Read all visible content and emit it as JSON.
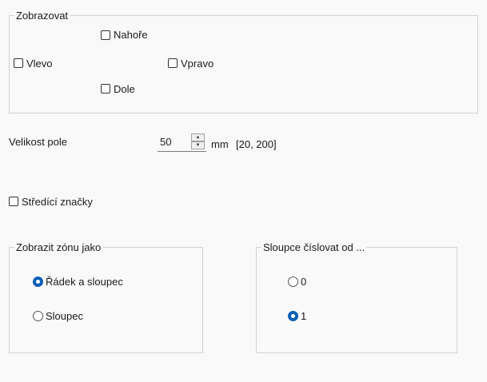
{
  "display_group": {
    "legend": "Zobrazovat",
    "top": {
      "label": "Nahoře",
      "checked": false
    },
    "left": {
      "label": "Vlevo",
      "checked": false
    },
    "right": {
      "label": "Vpravo",
      "checked": false
    },
    "bottom": {
      "label": "Dole",
      "checked": false
    }
  },
  "field_size": {
    "label": "Velikost pole",
    "value": "50",
    "unit": "mm",
    "range": "[20, 200]"
  },
  "center_marks": {
    "label": "Středící značky",
    "checked": false
  },
  "zone_group": {
    "legend": "Zobrazit zónu jako",
    "options": [
      {
        "label": "Řádek a sloupec",
        "selected": true
      },
      {
        "label": "Sloupec",
        "selected": false
      }
    ]
  },
  "column_group": {
    "legend": "Sloupce číslovat od ...",
    "options": [
      {
        "label": "0",
        "selected": false
      },
      {
        "label": "1",
        "selected": true
      }
    ]
  },
  "icons": {
    "spin_up": "chevron-up-icon",
    "spin_down": "chevron-down-icon"
  }
}
